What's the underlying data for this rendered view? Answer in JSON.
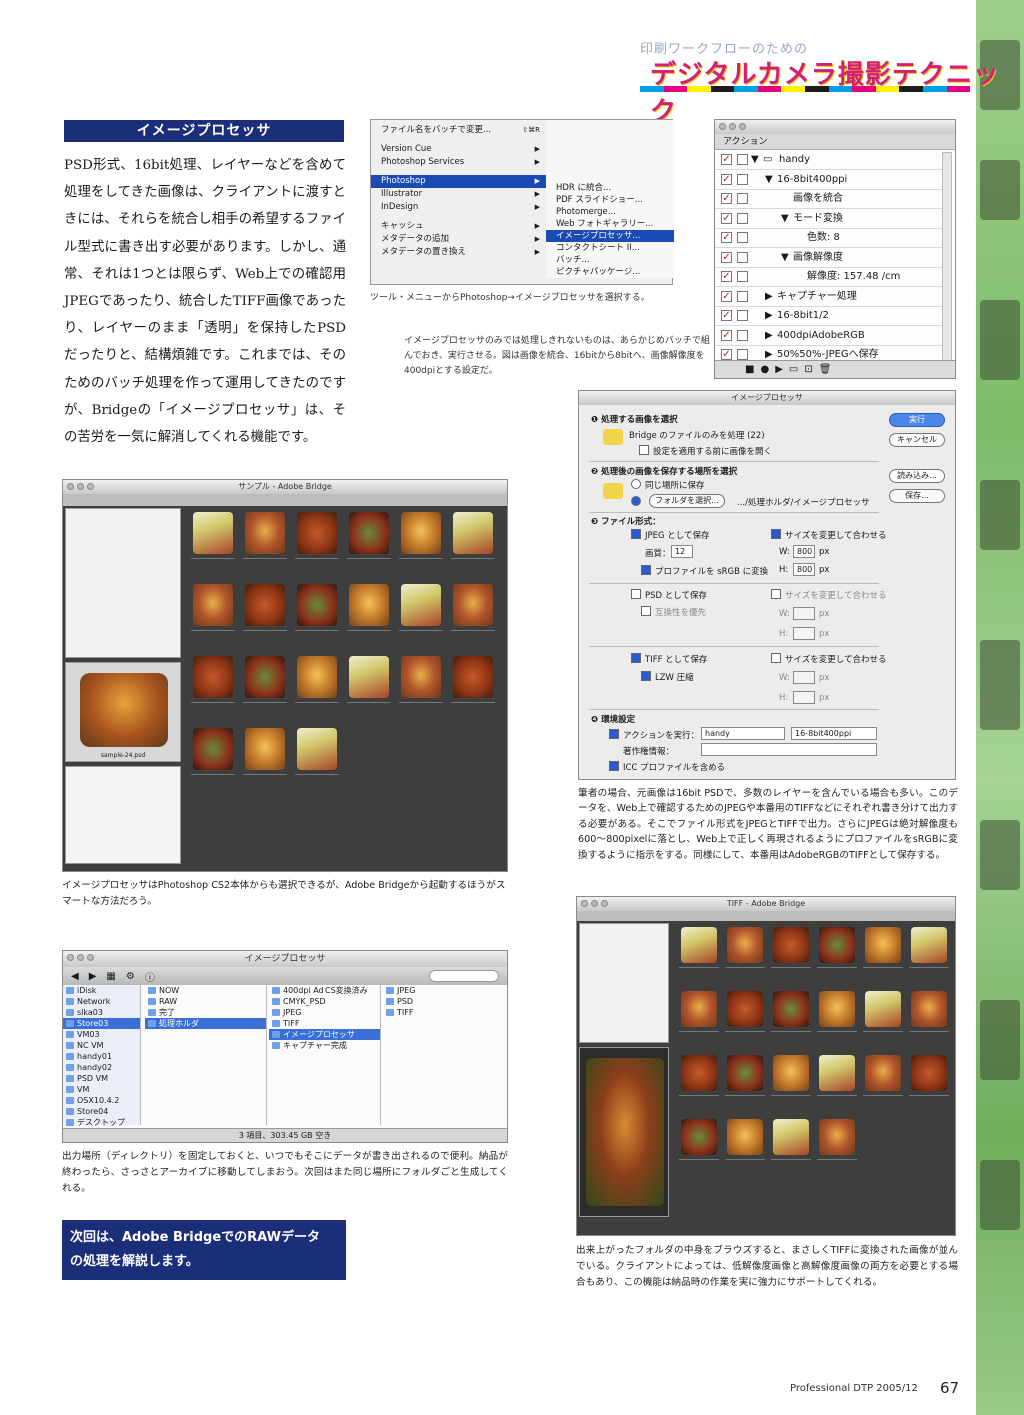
{
  "header": {
    "kicker": "印刷ワークフローのための",
    "title": "デジタルカメラ撮影テクニック",
    "color_bar": [
      "#00a0e9",
      "#e4007f",
      "#fff100",
      "#1a1a1a",
      "#00a0e9",
      "#e4007f",
      "#fff100",
      "#1a1a1a",
      "#00a0e9",
      "#e4007f",
      "#fff100",
      "#1a1a1a",
      "#00a0e9",
      "#e4007f"
    ]
  },
  "section": {
    "heading": "イメージプロセッサ",
    "body": "PSD形式、16bit処理、レイヤーなどを含めて処理をしてきた画像は、クライアントに渡すときには、それらを統合し相手の希望するファイル型式に書き出す必要があります。しかし、通常、それは1つとは限らず、Web上での確認用JPEGであったり、統合したTIFF画像であったり、レイヤーのまま「透明」を保持したPSDだったりと、結構煩雑です。これまでは、そのためのバッチ処理を作って運用してきたのですが、Bridgeの「イメージプロセッサ」は、その苦労を一気に解消してくれる機能です。"
  },
  "menu": {
    "items_left": [
      {
        "label": "ファイル名をバッチで変更...",
        "shortcut": "⇧⌘R"
      },
      {
        "label": "Version Cue",
        "arrow": "▶"
      },
      {
        "label": "Photoshop Services",
        "arrow": "▶"
      },
      {
        "label": "Photoshop",
        "arrow": "▶"
      },
      {
        "label": "Illustrator",
        "arrow": "▶"
      },
      {
        "label": "InDesign",
        "arrow": "▶"
      },
      {
        "label": "キャッシュ",
        "arrow": "▶"
      },
      {
        "label": "メタデータの追加",
        "arrow": "▶"
      },
      {
        "label": "メタデータの置き換え",
        "arrow": "▶"
      }
    ],
    "items_right": [
      "HDR に統合...",
      "PDF スライドショー...",
      "Photomerge...",
      "Web フォトギャラリー...",
      "イメージプロセッサ...",
      "コンタクトシート II...",
      "バッチ...",
      "ピクチャパッケージ..."
    ],
    "caption": "ツール・メニューからPhotoshop→イメージプロセッサを選択する。"
  },
  "action_panel": {
    "title": "アクション",
    "rows": [
      {
        "label": "handy"
      },
      {
        "label": "16-8bit400ppi"
      },
      {
        "label": "画像を統合"
      },
      {
        "label": "モード変換"
      },
      {
        "label": "色数: 8"
      },
      {
        "label": "画像解像度"
      },
      {
        "label": "解像度: 157.48 /cm"
      },
      {
        "label": "キャプチャー処理"
      },
      {
        "label": "16-8bit1/2"
      },
      {
        "label": "400dpiAdobeRGB"
      },
      {
        "label": "50%50%-JPEGへ保存"
      }
    ],
    "caption": "イメージプロセッサのみでは処理しきれないものは、あらかじめバッチで組んでおき、実行させる。図は画像を統合、16bitから8bitへ、画像解像度を400dpiとする設定だ。"
  },
  "dialog": {
    "title": "イメージプロセッサ",
    "step1": "処理する画像を選択",
    "step1_detail": "Bridge のファイルのみを処理 (22)",
    "step1_option": "設定を適用する前に画像を開く",
    "step2": "処理後の画像を保存する場所を選択",
    "step2_same": "同じ場所に保存",
    "step2_folder_btn": "フォルダを選択...",
    "step2_path": ".../処理ホルダ/イメージプロセッサ",
    "step3": "ファイル形式：",
    "jpeg_save": "JPEG として保存",
    "jpeg_resize": "サイズを変更して合わせる",
    "quality_label": "画質：",
    "quality_value": "12",
    "w_label": "W:",
    "h_label": "H:",
    "w_value": "800",
    "h_value": "800",
    "unit": "px",
    "srgb": "プロファイルを sRGB に変換",
    "psd_save": "PSD として保存",
    "psd_resize": "サイズを変更して合わせる",
    "psd_compat": "互換性を優先",
    "tiff_save": "TIFF として保存",
    "tiff_resize": "サイズを変更して合わせる",
    "lzw": "LZW 圧縮",
    "step4": "環境設定",
    "run_action": "アクションを実行：",
    "action_set": "handy",
    "action_name": "16-8bit400ppi",
    "copyright": "著作権情報：",
    "icc": "ICC プロファイルを含める",
    "btn_run": "実行",
    "btn_cancel": "キャンセル",
    "btn_load": "読み込み...",
    "btn_save": "保存...",
    "caption": "筆者の場合、元画像は16bit PSDで、多数のレイヤーを含んでいる場合も多い。このデータを、Web上で確認するためのJPEGや本番用のTIFFなどにそれぞれ書き分けて出力する必要がある。そこでファイル形式をJPEGとTIFFで出力。さらにJPEGは絶対解像度も600～800pixelに落とし、Web上で正しく再現されるようにプロファイルをsRGBに変換するように指示をする。同様にして、本番用はAdobeRGBのTIFFとして保存する。"
  },
  "bridge": {
    "title": "サンプル - Adobe Bridge",
    "caption": "イメージプロセッサはPhotoshop CS2本体からも選択できるが、Adobe Bridgeから起動するほうがスマートな方法だろう。",
    "preview_label": "sample-24.psd"
  },
  "finder": {
    "title": "イメージプロセッサ",
    "sidebar": [
      "iDisk",
      "Network",
      "slka03",
      "Store03",
      "VM03",
      "NC VM",
      "handy01",
      "handy02",
      "PSD VM",
      "VM",
      "OSX10.4.2",
      "Store04",
      "デスクトップ"
    ],
    "col1": [
      "NOW",
      "RAW",
      "完了",
      "処理ホルダ"
    ],
    "col2": [
      "400dpi Ad",
      "CMYK_PSD",
      "JPEG",
      "TIFF",
      "イメージプロセッサ",
      "キャプチャー完成"
    ],
    "col2_extra": "CS変換済み",
    "col3": [
      "JPEG",
      "PSD",
      "TIFF"
    ],
    "status": "3 項目、303.45 GB 空き",
    "caption": "出力場所（ディレクトリ）を固定しておくと、いつでもそこにデータが書き出されるので便利。納品が終わったら、さっさとアーカイブに移動してしまおう。次回はまた同じ場所にフォルダごと生成してくれる。"
  },
  "next": {
    "line1": "次回は、Adobe BridgeでのRAWデータ",
    "line2": "の処理を解説します。"
  },
  "bridge2": {
    "title": "TIFF - Adobe Bridge",
    "caption": "出来上がったフォルダの中身をブラウズすると、まさしくTIFFに変換された画像が並んでいる。クライアントによっては、低解像度画像と高解像度画像の両方を必要とする場合もあり、この機能は納品時の作業を実に強力にサポートしてくれる。"
  },
  "footer": {
    "magazine": "Professional DTP 2005/12",
    "page": "67"
  }
}
